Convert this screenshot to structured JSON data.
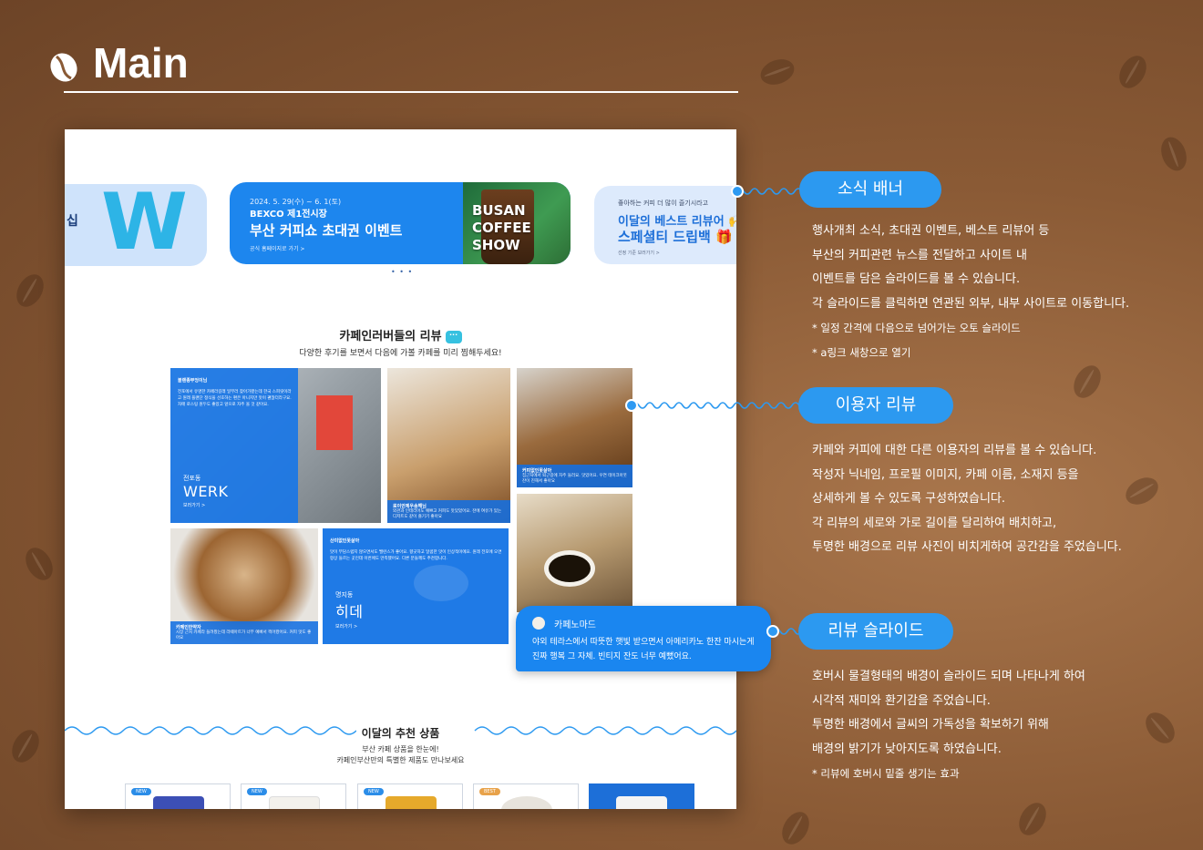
{
  "page": {
    "title": "Main"
  },
  "mockup": {
    "banners": {
      "left_partial": {
        "big_letter": "W",
        "side_text": "십"
      },
      "middle": {
        "date": "2024. 5. 29(수) ~ 6. 1(토)",
        "place": "BEXCO 제1전시장",
        "headline": "부산 커피쇼 초대권 이벤트",
        "link": "공식 홈페이지로 가기 >",
        "logo_text": "BUSAN COFFEE SHOW"
      },
      "right_partial": {
        "line1": "좋아하는 커피 더 많이 즐기시라고",
        "line2": "이달의 베스트 리뷰어 🙌",
        "line3": "스페셜티 드립백 🎁",
        "link": "선정 기준 보러가기 >"
      },
      "pager_dots": "• • •"
    },
    "reviews": {
      "title": "카페인러버들의 리뷰",
      "subtitle": "다양한 후기를 보면서 다음에 가볼 카페를 미리 찜해두세요!",
      "cards": [
        {
          "nickname": "블렌종부엉이님",
          "text": "전포에서 유명한 카페라길래 일부러 찾아가봤는데 한국 스피릿이라고 원래 플랜단 정식을 선호하는 편은 아니지만 맛이 괜찮더라구요. 자매 로스팅 원두도 좋았고 앞으로 자주 올 것 같아요.",
          "cafe_location": "전포동",
          "cafe_name": "WERK",
          "more": "보러가기 >"
        },
        {
          "nickname": "로이안제우송해님",
          "text": "외관과 인테리어도 예쁘고 커피도 맛있었어요. 잔에 여유가 있는 디저트도 같이 즐기기 좋아요"
        },
        {
          "nickname": "커피없인못살아",
          "text": "집근처에서 퇴근길에 자주 들러요. 맛있어요. 우연 테이크아웃 잔이 진해서 좋아요"
        },
        {
          "nickname": "카페인한약자",
          "text": "시장 근처 카페라 들려봤는데 라떼아트가 너무 예뻐서 찍어봤어요. 커피 맛도 좋아요"
        },
        {
          "nickname": "산미없인못살아",
          "text": "맛이 부담스럽지 않으면서도 밸런스가 좋아요. 향긋하고 달콤한 맛이 인상적이에요. 원래 전포에 오면 항상 들르는 곳인데 이번에도 만족했어요. 다른 분들께도 추천합니다.",
          "cafe_location": "명지동",
          "cafe_name": "히데",
          "more": "보러가기 >"
        }
      ],
      "hover_card": {
        "nickname": "카페노마드",
        "text": "야외 테라스에서 따뜻한 햇빛 받으면서 아메리카노 한잔 마시는게 진짜 행복 그 자체. 빈티지 잔도 너무 예뻤어요."
      }
    },
    "recommend": {
      "title": "이달의 추천 상품",
      "sub1": "부산 카페 상품을 한눈에!",
      "sub2": "카페인부산만의 특별한 제품도 만나보세요",
      "products": [
        {
          "badge": "NEW",
          "color": "#3c4fb5"
        },
        {
          "badge": "NEW",
          "color": "#f3f1ec"
        },
        {
          "badge": "NEW",
          "color": "#e6a92b"
        },
        {
          "badge": "BEST",
          "color": "#e7e3dc"
        },
        {
          "badge": "",
          "color": "#1d6fd8"
        }
      ]
    }
  },
  "annotations": [
    {
      "label": "소식 배너",
      "lines": [
        "행사개최 소식, 초대권 이벤트, 베스트 리뷰어 등",
        "부산의 커피관련 뉴스를 전달하고 사이트 내",
        "이벤트를 담은 슬라이드를 볼 수 있습니다.",
        "각 슬라이드를 클릭하면 연관된 외부, 내부 사이트로 이동합니다."
      ],
      "notes": [
        "* 일정 간격에 다음으로 넘어가는 오토 슬라이드",
        "* a링크 새창으로 열기"
      ]
    },
    {
      "label": "이용자 리뷰",
      "lines": [
        "카페와 커피에 대한 다른 이용자의 리뷰를 볼 수 있습니다.",
        "작성자 닉네임, 프로필 이미지, 카페 이름, 소재지 등을",
        "상세하게 볼 수 있도록 구성하였습니다.",
        "각 리뷰의 세로와 가로 길이를 달리하여 배치하고,",
        "투명한 배경으로 리뷰 사진이 비치게하여 공간감을 주었습니다."
      ],
      "notes": []
    },
    {
      "label": "리뷰 슬라이드",
      "lines": [
        "호버시 물결형태의 배경이 슬라이드 되며 나타나게 하여",
        "시각적 재미와 환기감을 주었습니다.",
        "투명한 배경에서 글씨의 가독성을 확보하기 위해",
        "배경의 밝기가 낮아지도록 하였습니다."
      ],
      "notes": [
        "* 리뷰에 호버시 밑줄 생기는 효과"
      ]
    }
  ],
  "colors": {
    "accent": "#2c99f0",
    "brand_blue": "#1d86ee",
    "background": "#8a5a35"
  }
}
